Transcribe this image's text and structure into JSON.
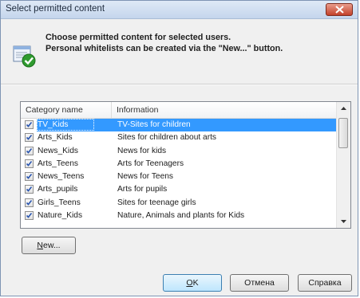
{
  "window": {
    "title": "Select permitted content"
  },
  "header": {
    "line1": "Choose permitted content for selected users.",
    "line2": "Personal whitelists can be created via the \"New...\" button."
  },
  "list": {
    "columns": [
      "Category name",
      "Information"
    ],
    "rows": [
      {
        "name": "TV_Kids",
        "info": "TV-Sites for children",
        "checked": true,
        "selected": true
      },
      {
        "name": "Arts_Kids",
        "info": "Sites for children about arts",
        "checked": true
      },
      {
        "name": "News_Kids",
        "info": "News for kids",
        "checked": true
      },
      {
        "name": "Arts_Teens",
        "info": "Arts for Teenagers",
        "checked": true
      },
      {
        "name": "News_Teens",
        "info": "News for Teens",
        "checked": true
      },
      {
        "name": "Arts_pupils",
        "info": "Arts for pupils",
        "checked": true
      },
      {
        "name": "Girls_Teens",
        "info": "Sites for teenage girls",
        "checked": true
      },
      {
        "name": "Nature_Kids",
        "info": "Nature, Animals and plants for Kids",
        "checked": true
      }
    ]
  },
  "buttons": {
    "new_first": "N",
    "new_rest": "ew...",
    "ok_first": "O",
    "ok_rest": "K",
    "cancel": "Отмена",
    "help": "Справка"
  },
  "colors": {
    "selection": "#3399ff",
    "check": "#2a9d2a"
  },
  "icons": [
    "close-icon",
    "approve-list-icon",
    "checkbox-check-icon",
    "scroll-up-arrow-icon",
    "scroll-down-arrow-icon"
  ]
}
